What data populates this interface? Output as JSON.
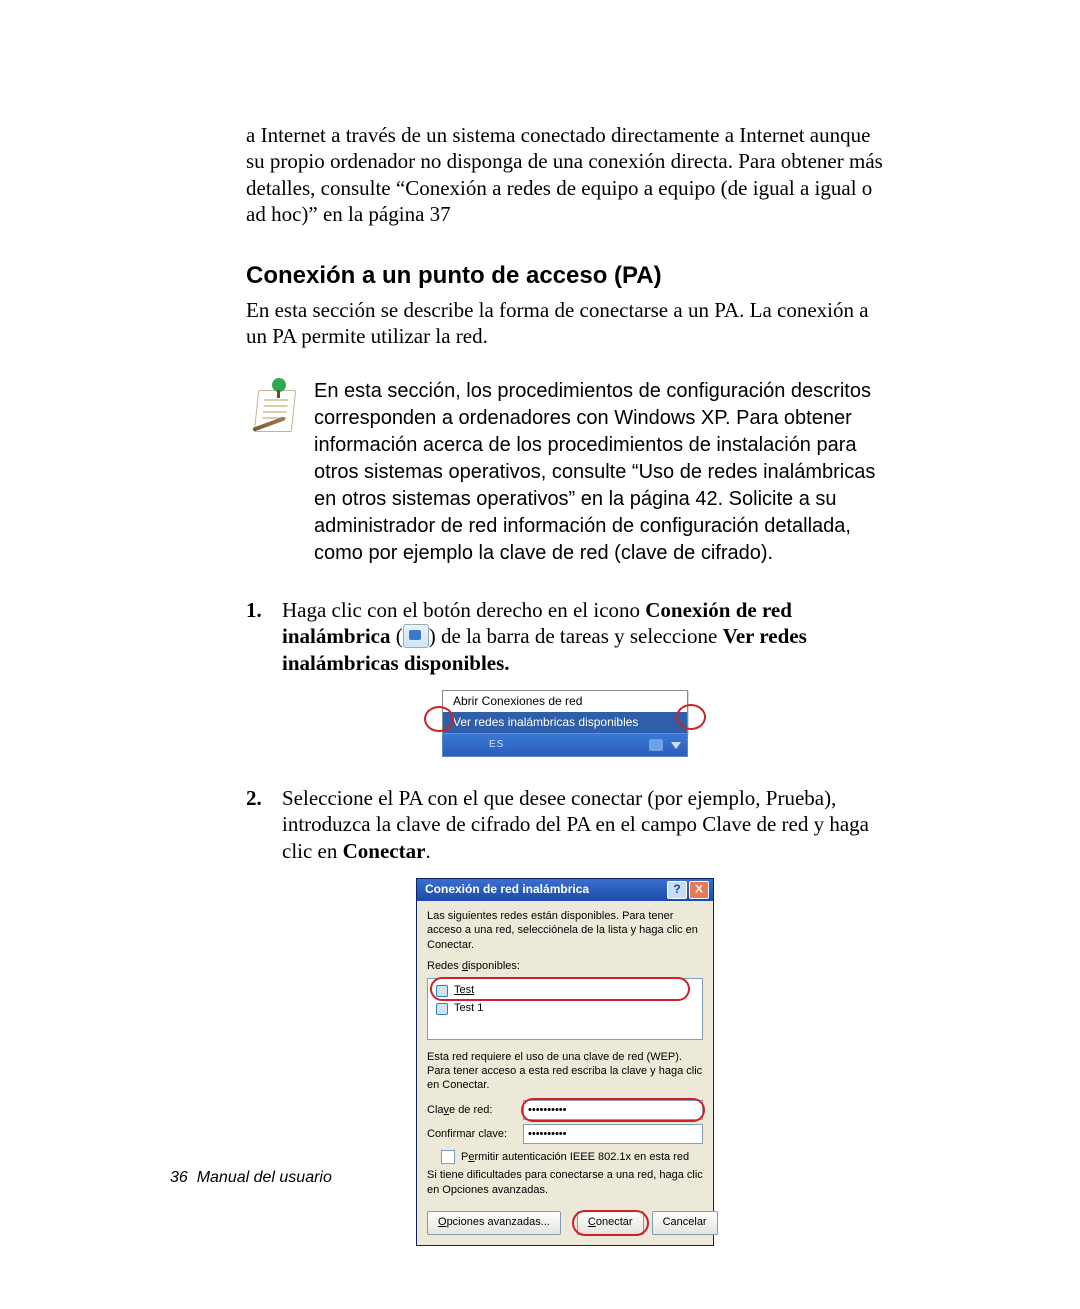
{
  "intro_para": "a Internet a través de un sistema conectado directamente a Internet aunque su propio ordenador no disponga de una conexión directa. Para obtener más detalles, consulte “Conexión a redes de equipo a equipo (de igual a igual o ad hoc)” en la página 37",
  "heading": "Conexión a un punto de acceso (PA)",
  "heading_para": "En esta sección se describe la forma de conectarse a un PA. La conexión a un PA permite utilizar la red.",
  "note": "En esta sección, los procedimientos de configuración descritos corresponden a ordenadores con Windows XP. Para obtener información acerca de los procedimientos de instalación para otros sistemas operativos, consulte “Uso de redes inalámbricas en otros sistemas operativos” en la página 42. Solicite a su administrador de red información de configuración detallada, como por ejemplo la clave de red (clave de cifrado).",
  "step1": {
    "num": "1.",
    "pre": "Haga clic con el botón derecho en el icono ",
    "bold1": "Conexión de red inalámbrica",
    "mid": " (",
    "post1": ") de la barra de tareas y seleccione ",
    "bold2": "Ver redes inalámbricas disponibles."
  },
  "menu": {
    "item1": "Abrir Conexiones de red",
    "item2": "Ver redes inalámbricas disponibles",
    "tb_label": "ES"
  },
  "step2": {
    "num": "2.",
    "pre": "Seleccione el PA con el que desee conectar (por ejemplo, Prueba), introduzca la clave de cifrado del PA en el campo Clave de red y haga clic en ",
    "bold": "Conectar",
    "post": "."
  },
  "dialog": {
    "title": "Conexión de red inalámbrica",
    "help": "?",
    "close": "X",
    "intro": "Las siguientes redes están disponibles. Para tener acceso a una red, selecciónela de la lista y haga clic en Conectar.",
    "available_pre": "Redes ",
    "available_u": "d",
    "available_post": "isponibles:",
    "net1": "Test",
    "net2": "Test 1",
    "wep": "Esta red requiere el uso de una clave de red (WEP). Para tener acceso a esta red escriba la clave y haga clic en Conectar.",
    "key_pre": "Cla",
    "key_u": "v",
    "key_post": "e de red:",
    "confirm": "Confirmar clave:",
    "mask": "••••••••••",
    "ieee_pre": "P",
    "ieee_u": "e",
    "ieee_post": "rmitir autenticación IEEE 802.1x en esta red",
    "trouble": "Si tiene dificultades para conectarse a una red, haga clic en Opciones avanzadas.",
    "adv_u": "O",
    "adv_post": "pciones avanzadas...",
    "connect_u": "C",
    "connect_post": "onectar",
    "cancel": "Cancelar"
  },
  "footer": {
    "page": "36",
    "title": "Manual del usuario"
  }
}
